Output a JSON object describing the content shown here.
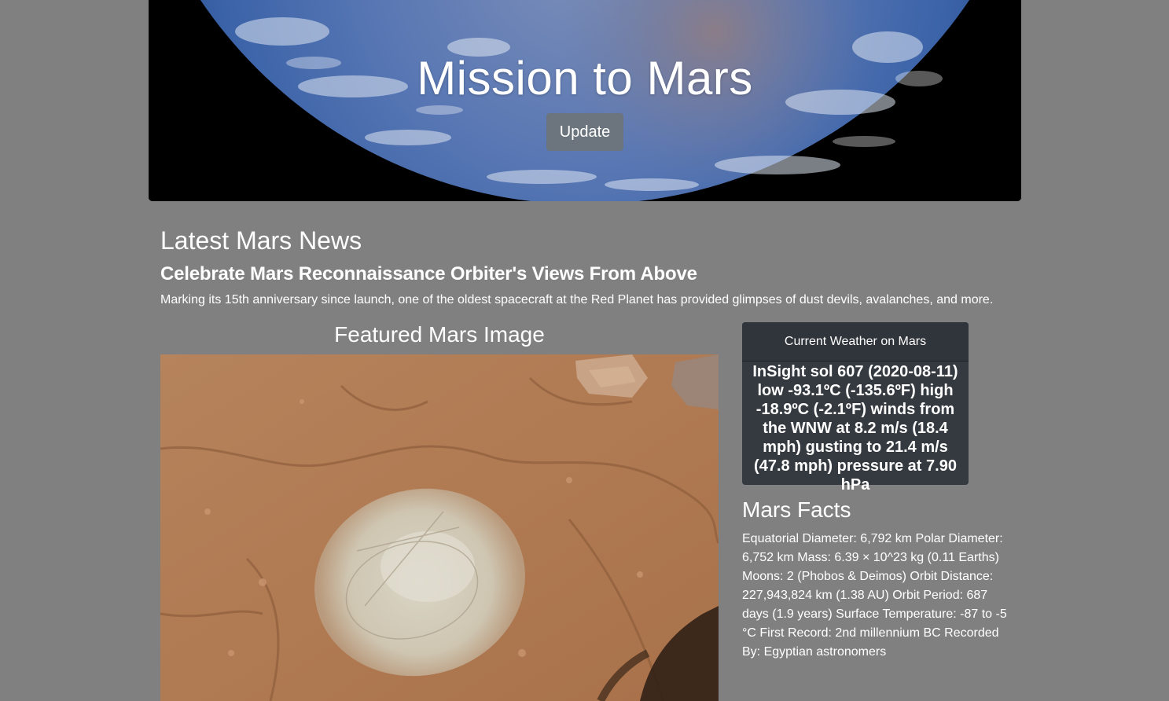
{
  "hero": {
    "title": "Mission to Mars",
    "update_button": "Update"
  },
  "news": {
    "heading": "Latest Mars News",
    "title": "Celebrate Mars Reconnaissance Orbiter's Views From Above",
    "teaser": "Marking its 15th anniversary since launch, one of the oldest spacecraft at the Red Planet has provided glimpses of dust devils, avalanches, and more."
  },
  "featured": {
    "heading": "Featured Mars Image"
  },
  "weather": {
    "header": "Current Weather on Mars",
    "body": "InSight sol 607 (2020-08-11) low -93.1ºC (-135.6ºF) high -18.9ºC (-2.1ºF) winds from the WNW at 8.2 m/s (18.4 mph) gusting to 21.4 m/s (47.8 mph) pressure at 7.90 hPa"
  },
  "facts": {
    "heading": "Mars Facts",
    "text": "Equatorial Diameter: 6,792 km Polar Diameter: 6,752 km Mass: 6.39 × 10^23 kg (0.11 Earths) Moons: 2 (Phobos & Deimos) Orbit Distance: 227,943,824 km (1.38 AU) Orbit Period: 687 days (1.9 years) Surface Temperature: -87 to -5 °C First Record: 2nd millennium BC Recorded By: Egyptian astronomers"
  },
  "colors": {
    "page_background": "#808080",
    "card_background": "#343a40",
    "button_background": "#6c757d"
  }
}
